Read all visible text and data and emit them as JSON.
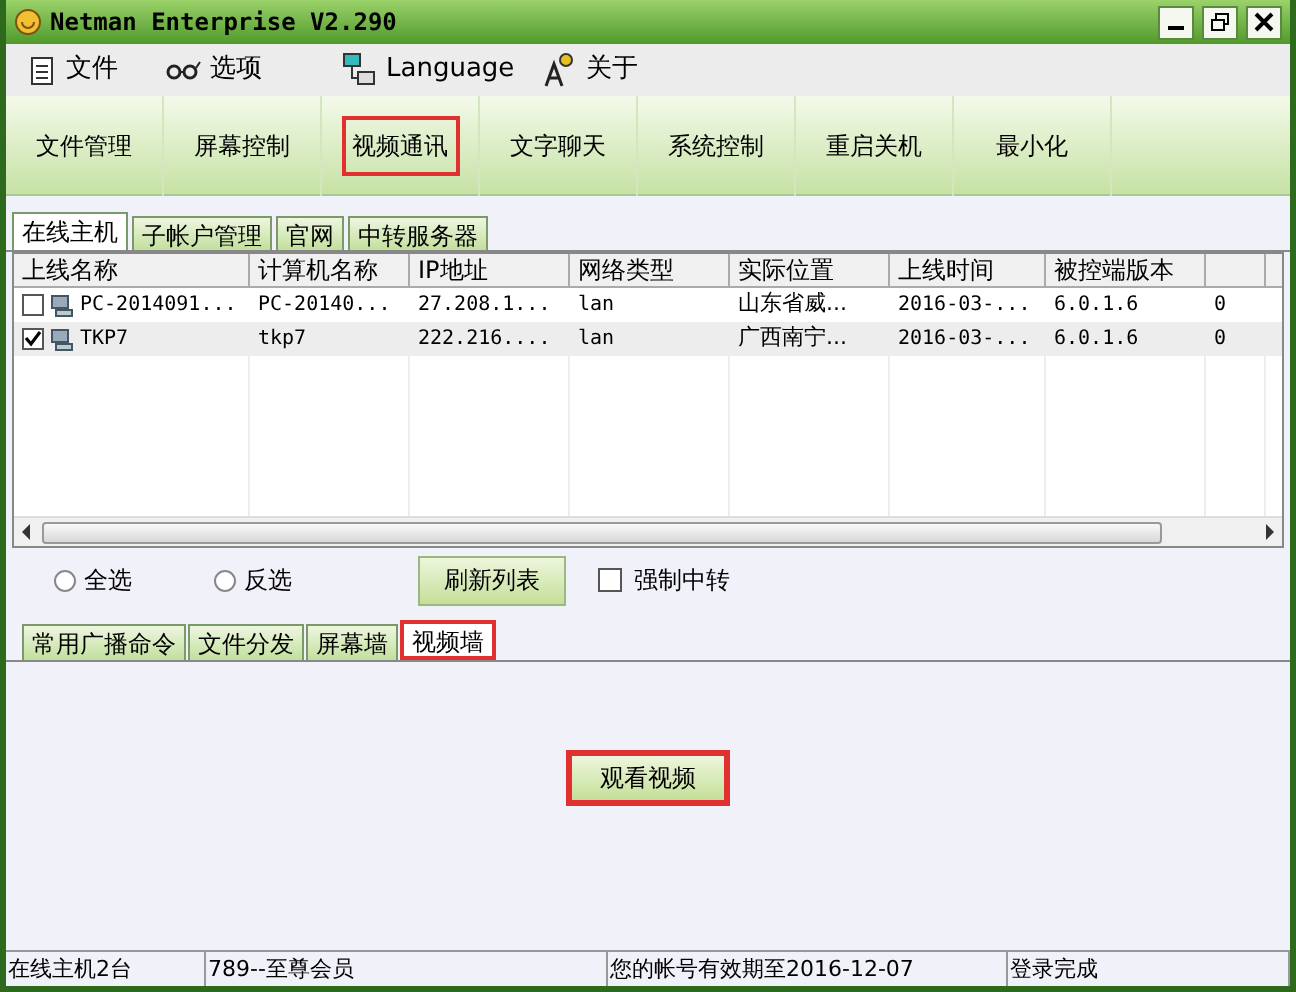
{
  "window": {
    "title": "Netman Enterprise V2.290"
  },
  "menu": [
    {
      "label": "文件"
    },
    {
      "label": "选项"
    },
    {
      "label": "Language"
    },
    {
      "label": "关于"
    }
  ],
  "toolbar": [
    {
      "label": "文件管理",
      "highlighted": false
    },
    {
      "label": "屏幕控制",
      "highlighted": false
    },
    {
      "label": "视频通讯",
      "highlighted": true
    },
    {
      "label": "文字聊天",
      "highlighted": false
    },
    {
      "label": "系统控制",
      "highlighted": false
    },
    {
      "label": "重启关机",
      "highlighted": false
    },
    {
      "label": "最小化",
      "highlighted": false
    }
  ],
  "tabs": [
    {
      "label": "在线主机",
      "selected": true
    },
    {
      "label": "子帐户管理",
      "selected": false
    },
    {
      "label": "官网",
      "selected": false
    },
    {
      "label": "中转服务器",
      "selected": false
    }
  ],
  "table": {
    "columns": [
      "上线名称",
      "计算机名称",
      "IP地址",
      "网络类型",
      "实际位置",
      "上线时间",
      "被控端版本",
      ""
    ],
    "rows": [
      {
        "checked": false,
        "selected": false,
        "cells": [
          "PC-2014091...",
          "PC-20140...",
          "27.208.1...",
          "lan",
          "山东省威...",
          "2016-03-...",
          "6.0.1.6",
          "0"
        ]
      },
      {
        "checked": true,
        "selected": true,
        "cells": [
          "TKP7",
          "tkp7",
          "222.216....",
          "lan",
          "广西南宁...",
          "2016-03-...",
          "6.0.1.6",
          "0"
        ]
      }
    ]
  },
  "controls": {
    "select_all": {
      "label": "全选",
      "selected": false
    },
    "invert": {
      "label": "反选",
      "selected": false
    },
    "refresh_button": "刷新列表",
    "force_relay": {
      "label": "强制中转",
      "checked": false
    }
  },
  "subtabs": [
    {
      "label": "常用广播命令",
      "selected": false,
      "highlighted": false
    },
    {
      "label": "文件分发",
      "selected": false,
      "highlighted": false
    },
    {
      "label": "屏幕墙",
      "selected": false,
      "highlighted": false
    },
    {
      "label": "视频墙",
      "selected": true,
      "highlighted": true
    }
  ],
  "watch_button": {
    "label": "观看视频",
    "highlighted": true
  },
  "status_bar": [
    "在线主机2台",
    "789--至尊会员",
    "您的帐号有效期至2016-12-07",
    "登录完成"
  ]
}
